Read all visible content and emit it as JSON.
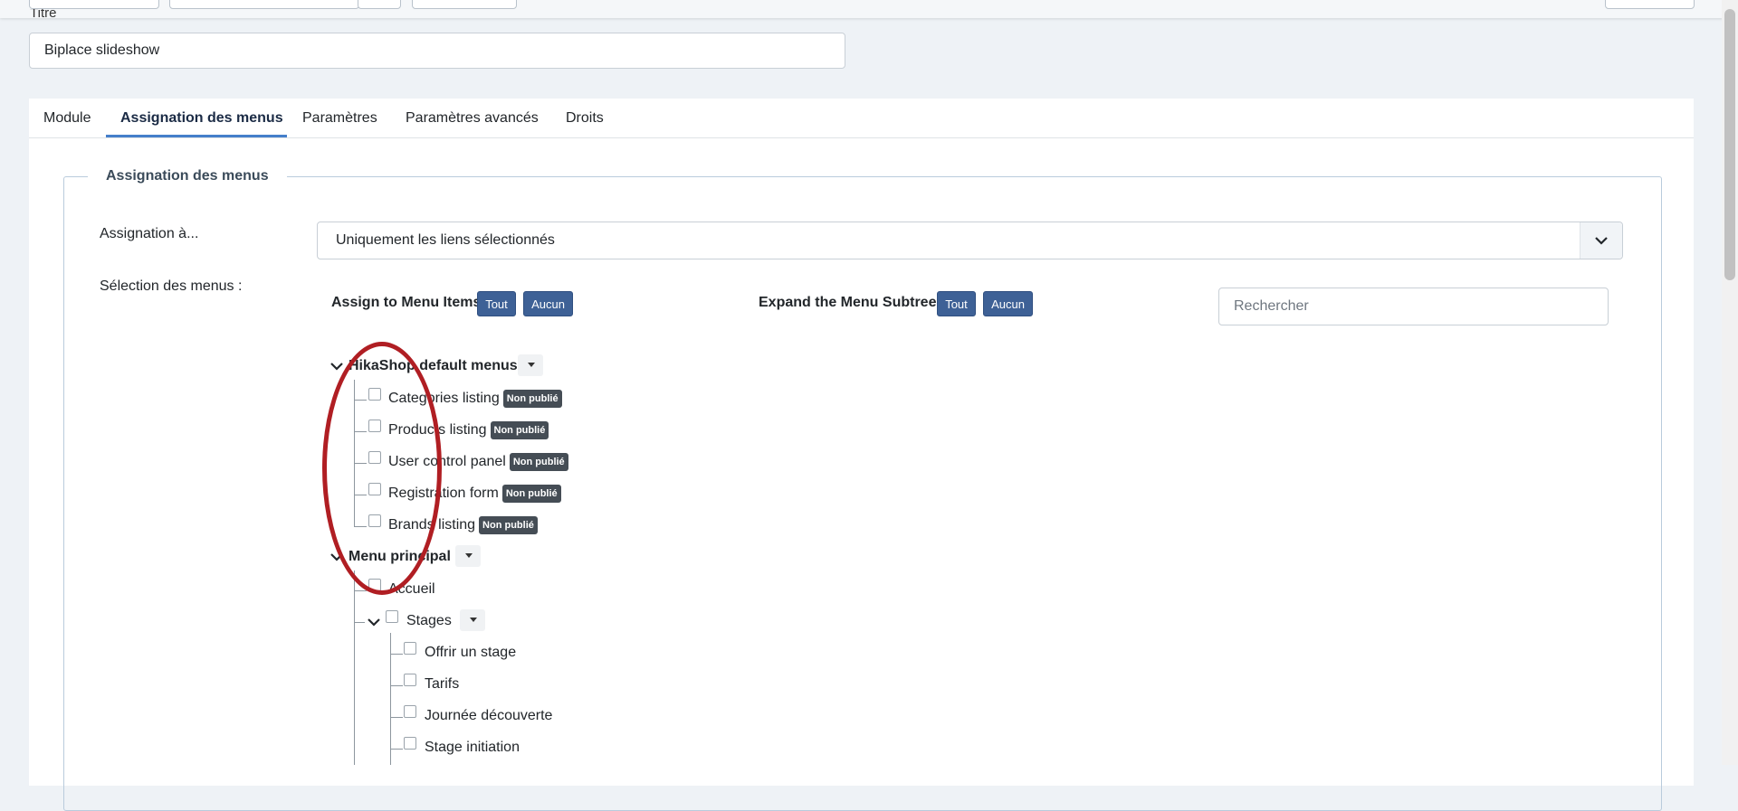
{
  "form": {
    "title_label": "Titre",
    "title_value": "Biplace slideshow"
  },
  "tabs": [
    "Module",
    "Assignation des menus",
    "Paramètres",
    "Paramètres avancés",
    "Droits"
  ],
  "menu_assignment": {
    "legend": "Assignation des menus",
    "assign_label": "Assignation à...",
    "assign_value": "Uniquement les liens sélectionnés",
    "selection_label": "Sélection des menus :",
    "assign_items_label": "Assign to Menu Items",
    "expand_label": "Expand the Menu Subtrees",
    "all_label": "Tout",
    "none_label": "Aucun",
    "search_placeholder": "Rechercher"
  },
  "tree": {
    "hikashop": {
      "title": "HikaShop default menus",
      "items": [
        {
          "label": "Categories listing",
          "badge": "Non publié"
        },
        {
          "label": "Products listing",
          "badge": "Non publié"
        },
        {
          "label": "User control panel",
          "badge": "Non publié"
        },
        {
          "label": "Registration form",
          "badge": "Non publié"
        },
        {
          "label": "Brands listing",
          "badge": "Non publié"
        }
      ]
    },
    "principal": {
      "title": "Menu principal",
      "home": "Accueil",
      "stages": {
        "label": "Stages",
        "children": [
          "Offrir un stage",
          "Tarifs",
          "Journée découverte",
          "Stage initiation"
        ]
      }
    }
  },
  "colors": {
    "accent": "#457fca",
    "button": "#3e6196",
    "badge": "#454d55",
    "annotation": "#b01e23"
  }
}
